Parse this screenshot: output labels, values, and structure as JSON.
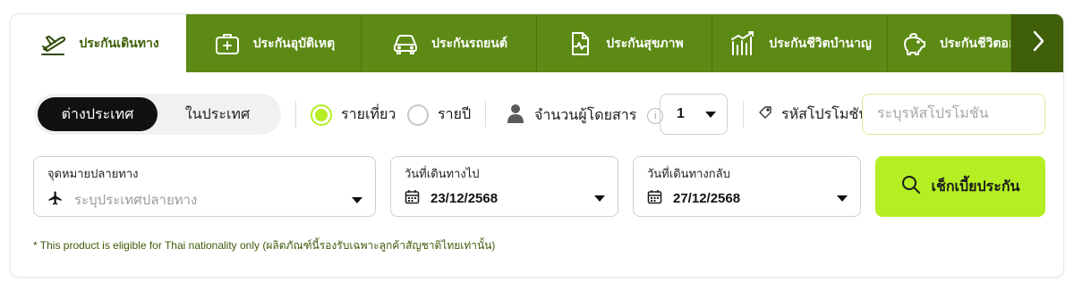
{
  "tabs": [
    {
      "label": "ประกันเดินทาง",
      "icon": "plane-icon",
      "active": true
    },
    {
      "label": "ประกันอุบัติเหตุ",
      "icon": "medical-kit-icon",
      "active": false
    },
    {
      "label": "ประกันรถยนต์",
      "icon": "car-icon",
      "active": false
    },
    {
      "label": "ประกันสุขภาพ",
      "icon": "health-document-icon",
      "active": false
    },
    {
      "label": "ประกันชีวิตบำนาญ",
      "icon": "growth-chart-icon",
      "active": false
    },
    {
      "label": "ประกันชีวิตออ",
      "icon": "piggy-bank-icon",
      "active": false
    }
  ],
  "trip_scope": {
    "international": "ต่างประเทศ",
    "domestic": "ในประเทศ",
    "selected": "international"
  },
  "trip_type": {
    "per_trip": "รายเที่ยว",
    "annual": "รายปี",
    "selected": "per_trip"
  },
  "passengers": {
    "label": "จำนวนผู้โดยสาร",
    "info_glyph": "i",
    "value": "1"
  },
  "promo": {
    "label": "รหัสโปรโมชัน",
    "placeholder": "ระบุรหัสโปรโมชัน"
  },
  "destination": {
    "label": "จุดหมายปลายทาง",
    "placeholder": "ระบุประเทศปลายทาง"
  },
  "depart": {
    "label": "วันที่เดินทางไป",
    "value": "23/12/2568"
  },
  "return": {
    "label": "วันที่เดินทางกลับ",
    "value": "27/12/2568"
  },
  "search_button": "เช็กเบี้ยประกัน",
  "note": "* This product is eligible for Thai nationality only (ผลิตภัณฑ์นี้รองรับเฉพาะลูกค้าสัญชาติไทยเท่านั้น)",
  "colors": {
    "brand_green": "#5c8a14",
    "dark_green": "#3f5f08",
    "accent_lime": "#b4ee23",
    "text_green": "#3d5a0a"
  }
}
